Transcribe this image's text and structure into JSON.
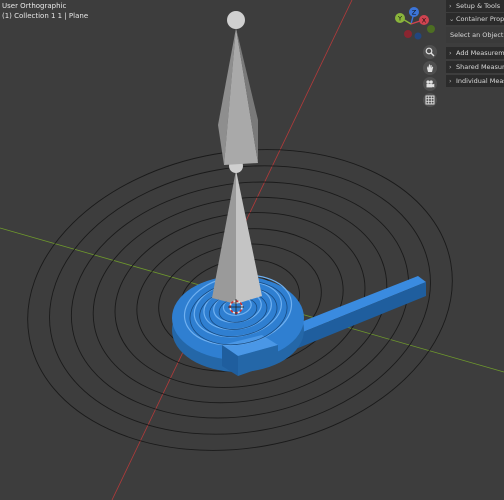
{
  "viewport": {
    "title": "User Orthographic",
    "collection": "(1) Collection 1 1 | Plane",
    "colors": {
      "background": "#3d3d3d",
      "ring_line": "#1a1a1a",
      "x_axis": "#b33a3a",
      "y_axis": "#6f9a2c",
      "spiral": "#2f7fd1",
      "spiral_dark": "#1f5e9e",
      "cone_light": "#a8a8a8",
      "cone_dark": "#7a7a7a"
    }
  },
  "gizmo": {
    "axes": [
      {
        "label": "Z",
        "color": "#3b74d8"
      },
      {
        "label": "Y",
        "color": "#8ab53b"
      },
      {
        "label": "X",
        "color": "#d04350"
      }
    ],
    "buttons": [
      {
        "name": "zoom",
        "icon": "magnifier-icon"
      },
      {
        "name": "pan",
        "icon": "hand-icon"
      },
      {
        "name": "camera",
        "icon": "camera-icon"
      },
      {
        "name": "grid",
        "icon": "grid-icon"
      }
    ]
  },
  "npanel": {
    "setup_tools": "Setup & Tools",
    "container_properties": "Container Properties",
    "select_object": "Select an Object",
    "add_measurements": "Add Measurements",
    "shared_measurements": "Shared Measurements",
    "individual_measurements": "Individual Measurements"
  }
}
